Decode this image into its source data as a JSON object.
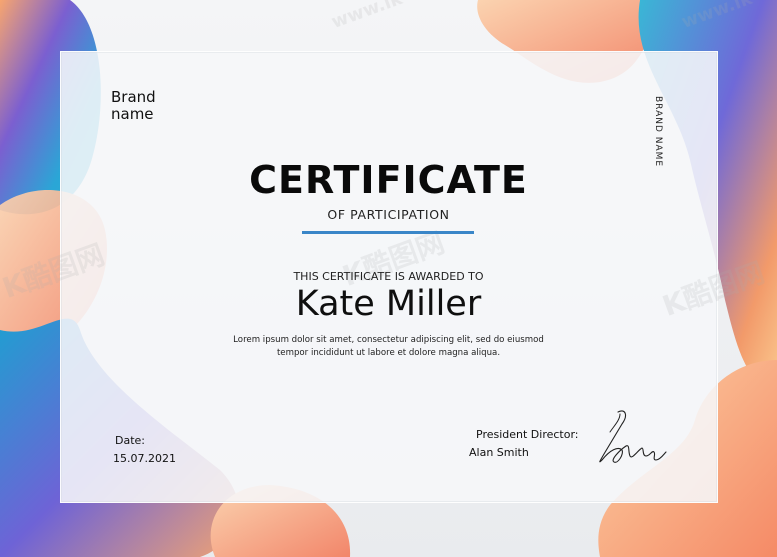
{
  "colors": {
    "accent_underline": "#3a86c8",
    "blob_blue": "#2aa6d6",
    "blob_purple": "#7b5fd0",
    "blob_orange": "#f39a6a",
    "blob_peach": "#fcd7b5"
  },
  "certificate": {
    "brand_left": "Brand\nname",
    "brand_right": "BRAND NAME",
    "title": "CERTIFICATE",
    "subtitle": "OF PARTICIPATION",
    "awarded_to": "THIS CERTIFICATE IS AWARDED TO",
    "recipient": "Kate Miller",
    "body_line1": "Lorem ipsum dolor sit amet, consectetur adipiscing elit, sed do eiusmod",
    "body_line2": "tempor incididunt ut labore et dolore magna aliqua.",
    "date_label": "Date:",
    "date_value": "15.07.2021",
    "signer_title": "President Director:",
    "signer_name": "Alan Smith"
  },
  "watermark": {
    "site": "www.ikutu.com",
    "logo": "K酷图网"
  },
  "icons": [
    "signature-icon",
    "watermark-logo-icon"
  ]
}
